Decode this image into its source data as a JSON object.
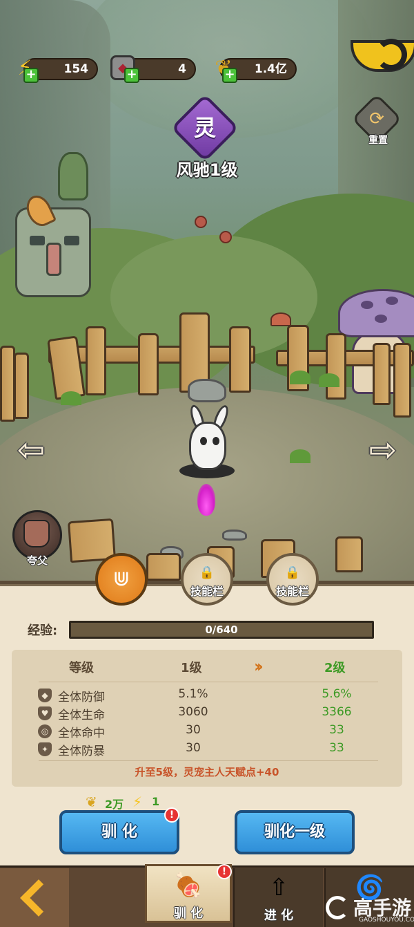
{
  "resources": [
    {
      "icon": "lightning-icon",
      "value": "154"
    },
    {
      "icon": "stone-icon",
      "value": "4"
    },
    {
      "icon": "grain-icon",
      "value": "1.4亿"
    }
  ],
  "pet": {
    "grade_char": "灵",
    "name": "风驰1级"
  },
  "reset_label": "重置",
  "owner": {
    "label": "夸父"
  },
  "slots": [
    {
      "label": "",
      "active": true
    },
    {
      "label": "技能栏"
    },
    {
      "label": "技能栏"
    }
  ],
  "experience": {
    "label": "经验:",
    "text": "0/640",
    "progress": 0
  },
  "stats": {
    "header_label": "等级",
    "current_level": "1级",
    "next_level": "2级",
    "rows": [
      {
        "name": "全体防御",
        "current": "5.1%",
        "next": "5.6%"
      },
      {
        "name": "全体生命",
        "current": "3060",
        "next": "3366"
      },
      {
        "name": "全体命中",
        "current": "30",
        "next": "33"
      },
      {
        "name": "全体防暴",
        "current": "30",
        "next": "33"
      }
    ],
    "bonus": "升至5级，灵宠主人天赋点+40"
  },
  "cost": {
    "grain": "2万",
    "energy": "1"
  },
  "buttons": {
    "tame": "驯 化",
    "tame_badge": "!",
    "tame_one_level": "驯化一级"
  },
  "nav": {
    "tabs": [
      {
        "label": "驯 化",
        "badge": "!"
      },
      {
        "label": "进 化"
      },
      {
        "label": ""
      }
    ]
  },
  "watermark": {
    "title": "高手游",
    "sub": "GAOSHOUYOU.COM"
  }
}
